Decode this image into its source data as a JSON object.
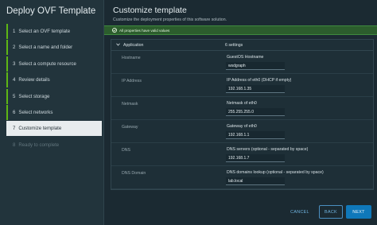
{
  "wizard": {
    "title": "Deploy OVF Template",
    "steps": [
      {
        "num": "1",
        "label": "Select an OVF template"
      },
      {
        "num": "2",
        "label": "Select a name and folder"
      },
      {
        "num": "3",
        "label": "Select a compute resource"
      },
      {
        "num": "4",
        "label": "Review details"
      },
      {
        "num": "5",
        "label": "Select storage"
      },
      {
        "num": "6",
        "label": "Select networks"
      },
      {
        "num": "7",
        "label": "Customize template"
      },
      {
        "num": "8",
        "label": "Ready to complete"
      }
    ]
  },
  "page": {
    "title": "Customize template",
    "subtitle": "Customize the deployment properties of this software solution."
  },
  "alert": {
    "text": "All properties have valid values"
  },
  "section": {
    "name": "Application",
    "count": "6 settings"
  },
  "rows": [
    {
      "label": "Hostname",
      "desc": "GuestOS Hostname",
      "value": "wsdgraph"
    },
    {
      "label": "IP Address",
      "desc": "IP Address of eth0 (DHCP if empty)",
      "value": "192.168.1.35"
    },
    {
      "label": "Netmask",
      "desc": "Netmask of eth0",
      "value": "255.255.255.0"
    },
    {
      "label": "Gateway",
      "desc": "Gateway of eth0",
      "value": "192.168.1.1"
    },
    {
      "label": "DNS",
      "desc": "DNS servers (optional - separated by space)",
      "value": "192.168.1.7"
    },
    {
      "label": "DNS Domain",
      "desc": "DNS domains lookup (optional - separated by space)",
      "value": "lab.local"
    }
  ],
  "buttons": {
    "cancel": "CANCEL",
    "back": "BACK",
    "next": "NEXT"
  },
  "colors": {
    "accent": "#0f78ba",
    "success": "#5eb715",
    "alert_bg": "#2c5d2d"
  }
}
